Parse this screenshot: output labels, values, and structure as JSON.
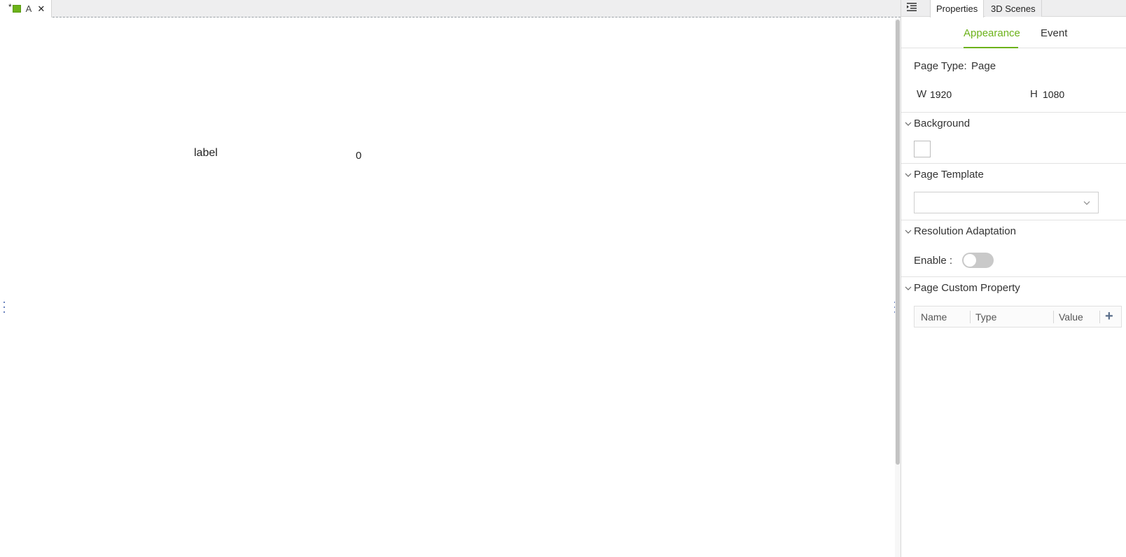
{
  "editor": {
    "tab": {
      "dirty_mark": "*",
      "label": "A",
      "close": "✕"
    },
    "canvas": {
      "label_text": "label",
      "number_text": "0"
    }
  },
  "panel": {
    "tabs": [
      {
        "label": "Properties",
        "active": true
      },
      {
        "label": "3D Scenes",
        "active": false
      }
    ],
    "subtabs": [
      {
        "label": "Appearance",
        "active": true
      },
      {
        "label": "Event",
        "active": false
      }
    ],
    "page_type": {
      "label": "Page Type:",
      "value": "Page"
    },
    "size": {
      "w_label": "W",
      "w_value": "1920",
      "h_label": "H",
      "h_value": "1080"
    },
    "sections": {
      "background": "Background",
      "page_template": "Page Template",
      "resolution": "Resolution Adaptation",
      "custom_property": "Page Custom Property"
    },
    "resolution": {
      "enable_label": "Enable :",
      "enabled": false
    },
    "template_select": {
      "value": ""
    },
    "property_table": {
      "headers": [
        "Name",
        "Type",
        "Value"
      ],
      "add_label": "+"
    }
  },
  "colors": {
    "accent": "#6cb21a",
    "page_icon": "#6cb21a",
    "toggle_off": "#c9c9c9"
  },
  "icons": {
    "outline": "outline-icon",
    "page": "page-icon",
    "close": "close-icon",
    "chevron": "chevron-down-icon",
    "add": "plus-icon"
  }
}
